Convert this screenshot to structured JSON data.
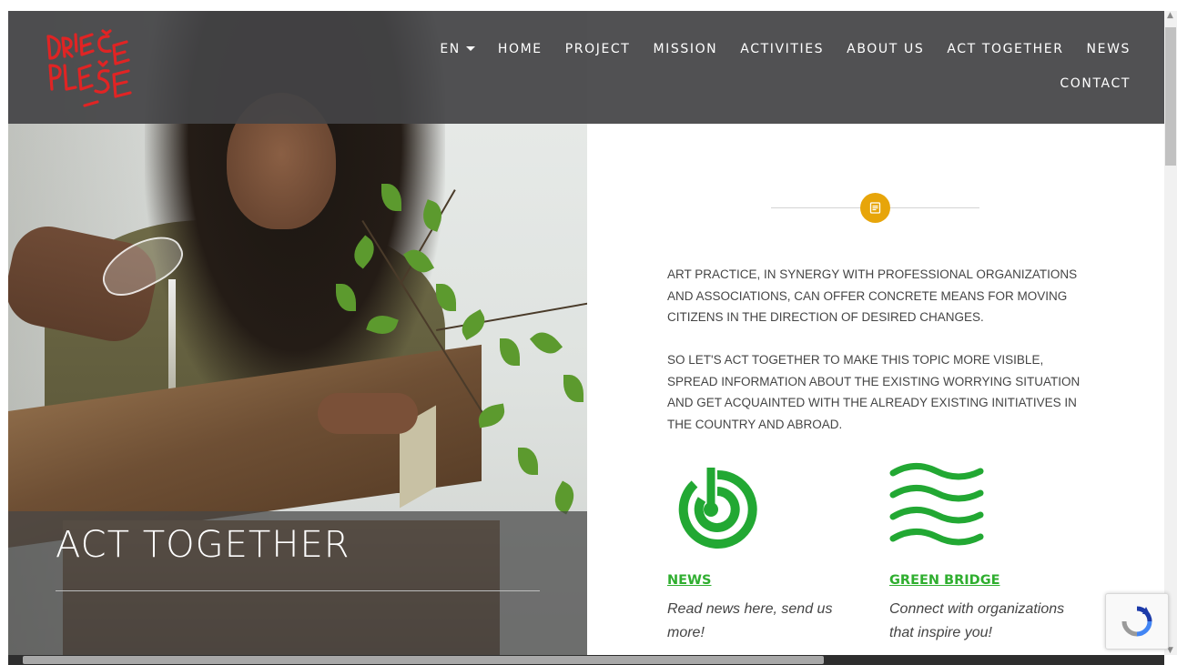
{
  "logo": {
    "alt": "DRIEČE PLEŠE"
  },
  "nav": {
    "language": "EN",
    "row1": [
      "HOME",
      "PROJECT",
      "MISSION",
      "ACTIVITIES",
      "ABOUT US",
      "ACT TOGETHER",
      "NEWS"
    ],
    "row2": [
      "CONTACT"
    ]
  },
  "hero": {
    "title": "ACT TOGETHER"
  },
  "content": {
    "paragraph1": "ART PRACTICE, IN SYNERGY WITH PROFESSIONAL ORGANIZATIONS AND ASSOCIATIONS, CAN OFFER CONCRETE MEANS FOR MOVING CITIZENS IN THE DIRECTION OF DESIRED CHANGES.",
    "paragraph2": "SO LET'S ACT TOGETHER TO MAKE THIS TOPIC MORE VISIBLE, SPREAD INFORMATION ABOUT THE EXISTING WORRYING SITUATION AND GET ACQUAINTED WITH THE ALREADY EXISTING INITIATIVES IN THE COUNTRY AND ABROAD.",
    "cards": [
      {
        "title": "NEWS",
        "text": "Read news here, send us more!",
        "icon": "radar-icon"
      },
      {
        "title": "GREEN BRIDGE",
        "text": "Connect with organizations that inspire you!",
        "icon": "waves-icon"
      }
    ]
  },
  "colors": {
    "accent": "#e7a50a",
    "green": "#2fae2f",
    "logo_red": "#e02424",
    "nav_bg": "#444446"
  }
}
